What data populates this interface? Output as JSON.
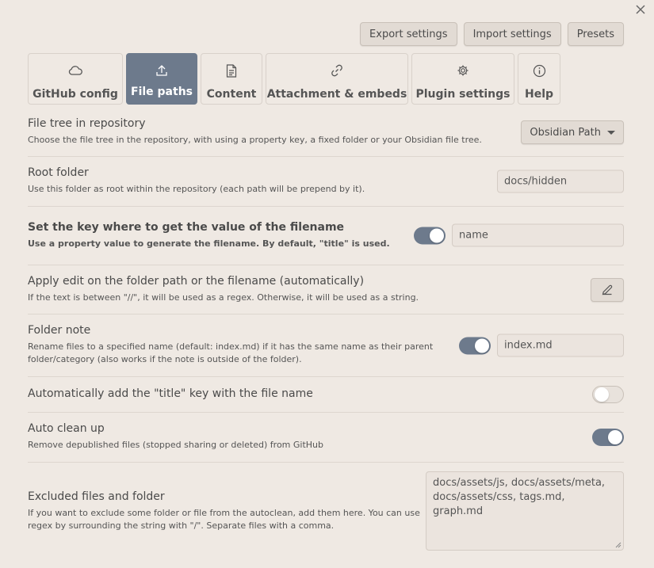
{
  "toolbar": {
    "export_label": "Export settings",
    "import_label": "Import settings",
    "presets_label": "Presets"
  },
  "tabs": [
    {
      "label": "GitHub config",
      "icon": "cloud-icon"
    },
    {
      "label": "File paths",
      "icon": "upload-icon",
      "active": true
    },
    {
      "label": "Content",
      "icon": "file-text-icon"
    },
    {
      "label": "Attachment & embeds",
      "icon": "link-icon"
    },
    {
      "label": "Plugin settings",
      "icon": "gear-icon"
    },
    {
      "label": "Help",
      "icon": "info-icon"
    }
  ],
  "settings": {
    "file_tree": {
      "name": "File tree in repository",
      "desc": "Choose the file tree in the repository, with using a property key, a fixed folder or your Obsidian file tree.",
      "value": "Obsidian Path"
    },
    "root_folder": {
      "name": "Root folder",
      "desc": "Use this folder as root within the repository (each path will be prepend by it).",
      "value": "docs/hidden"
    },
    "filename_key": {
      "name": "Set the key where to get the value of the filename",
      "desc": "Use a property value to generate the filename. By default, \"title\" is used.",
      "value": "name",
      "enabled": true
    },
    "apply_edit": {
      "name": "Apply edit on the folder path or the filename (automatically)",
      "desc": "If the text is between \"//\", it will be used as a regex. Otherwise, it will be used as a string."
    },
    "folder_note": {
      "name": "Folder note",
      "desc_line1": "Rename files to a specified name (default: index.md) if it has the same name as their parent",
      "desc_line2": "folder/category (also works if the note is outside of the folder).",
      "value": "index.md",
      "enabled": true
    },
    "auto_title": {
      "name": "Automatically add the \"title\" key with the file name",
      "enabled": false
    },
    "auto_clean": {
      "name": "Auto clean up",
      "desc": "Remove depublished files (stopped sharing or deleted) from GitHub",
      "enabled": true
    },
    "excluded": {
      "name": "Excluded files and folder",
      "desc_line1": "If you want to exclude some folder or file from the autoclean, add them here. You can use",
      "desc_line2": "regex by surrounding the string with \"/\". Separate files with a comma.",
      "value_line1": "docs/assets/js, docs/assets/meta,",
      "value_line2": "docs/assets/css, tags.md, graph.md"
    }
  },
  "colors": {
    "accent": "#6d7a8c",
    "background": "#efe9e3"
  }
}
